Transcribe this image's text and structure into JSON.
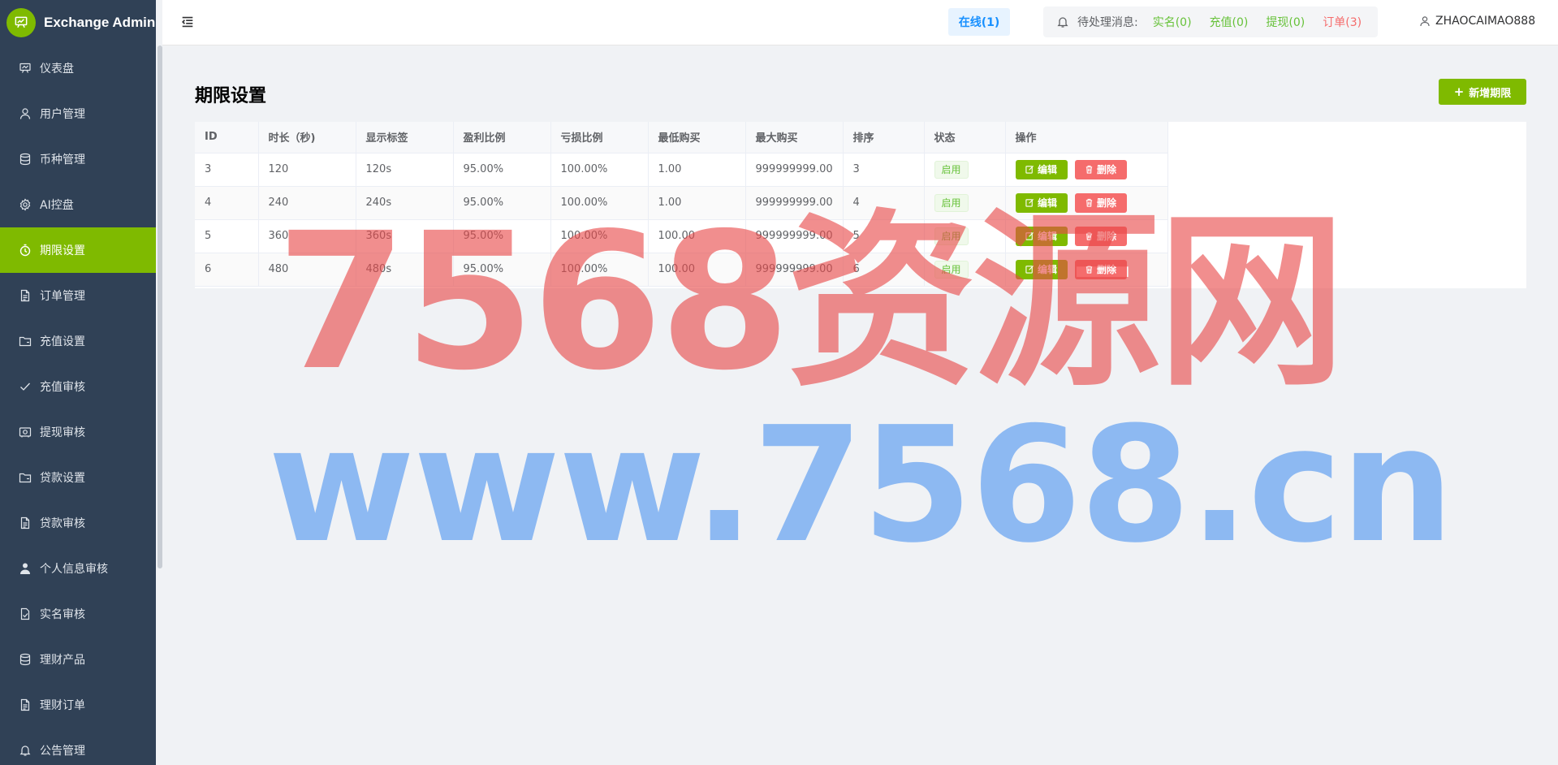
{
  "app": {
    "title": "Exchange Admin"
  },
  "sidebar": {
    "items": [
      {
        "label": "仪表盘",
        "icon": "dashboard-icon"
      },
      {
        "label": "用户管理",
        "icon": "user-icon"
      },
      {
        "label": "币种管理",
        "icon": "database-icon"
      },
      {
        "label": "AI控盘",
        "icon": "gear-icon"
      },
      {
        "label": "期限设置",
        "icon": "timer-icon",
        "active": true
      },
      {
        "label": "订单管理",
        "icon": "document-icon"
      },
      {
        "label": "充值设置",
        "icon": "folder-icon"
      },
      {
        "label": "充值审核",
        "icon": "check-icon"
      },
      {
        "label": "提现审核",
        "icon": "withdraw-icon"
      },
      {
        "label": "贷款设置",
        "icon": "folder-icon"
      },
      {
        "label": "贷款审核",
        "icon": "document-icon"
      },
      {
        "label": "个人信息审核",
        "icon": "person-icon"
      },
      {
        "label": "实名审核",
        "icon": "verified-doc-icon"
      },
      {
        "label": "理财产品",
        "icon": "database-icon"
      },
      {
        "label": "理财订单",
        "icon": "document-icon"
      },
      {
        "label": "公告管理",
        "icon": "bell-icon"
      }
    ]
  },
  "header": {
    "online": "在线(1)",
    "pending_label": "待处理消息:",
    "pending": {
      "realname": "实名(0)",
      "recharge": "充值(0)",
      "withdraw": "提现(0)",
      "order": "订单(3)"
    },
    "username": "ZHAOCAIMAO888"
  },
  "main": {
    "title": "期限设置",
    "add_button": "新增期限",
    "table": {
      "columns": [
        "ID",
        "时长（秒)",
        "显示标签",
        "盈利比例",
        "亏损比例",
        "最低购买",
        "最大购买",
        "排序",
        "状态",
        "操作"
      ],
      "rows": [
        {
          "id": "3",
          "duration": "120",
          "label": "120s",
          "profit": "95.00%",
          "loss": "100.00%",
          "min": "1.00",
          "max": "999999999.00",
          "sort": "3",
          "status": "启用"
        },
        {
          "id": "4",
          "duration": "240",
          "label": "240s",
          "profit": "95.00%",
          "loss": "100.00%",
          "min": "1.00",
          "max": "999999999.00",
          "sort": "4",
          "status": "启用"
        },
        {
          "id": "5",
          "duration": "360",
          "label": "360s",
          "profit": "95.00%",
          "loss": "100.00%",
          "min": "100.00",
          "max": "999999999.00",
          "sort": "5",
          "status": "启用"
        },
        {
          "id": "6",
          "duration": "480",
          "label": "480s",
          "profit": "95.00%",
          "loss": "100.00%",
          "min": "100.00",
          "max": "999999999.00",
          "sort": "6",
          "status": "启用"
        }
      ],
      "edit_label": "编辑",
      "delete_label": "删除"
    }
  },
  "watermark": {
    "line1": "7568资源网",
    "line2": "www.7568.cn"
  },
  "colors": {
    "sidebar_bg": "#304156",
    "accent": "#7fba00",
    "danger": "#f56c6c",
    "success": "#67c23a",
    "info": "#1890ff"
  }
}
